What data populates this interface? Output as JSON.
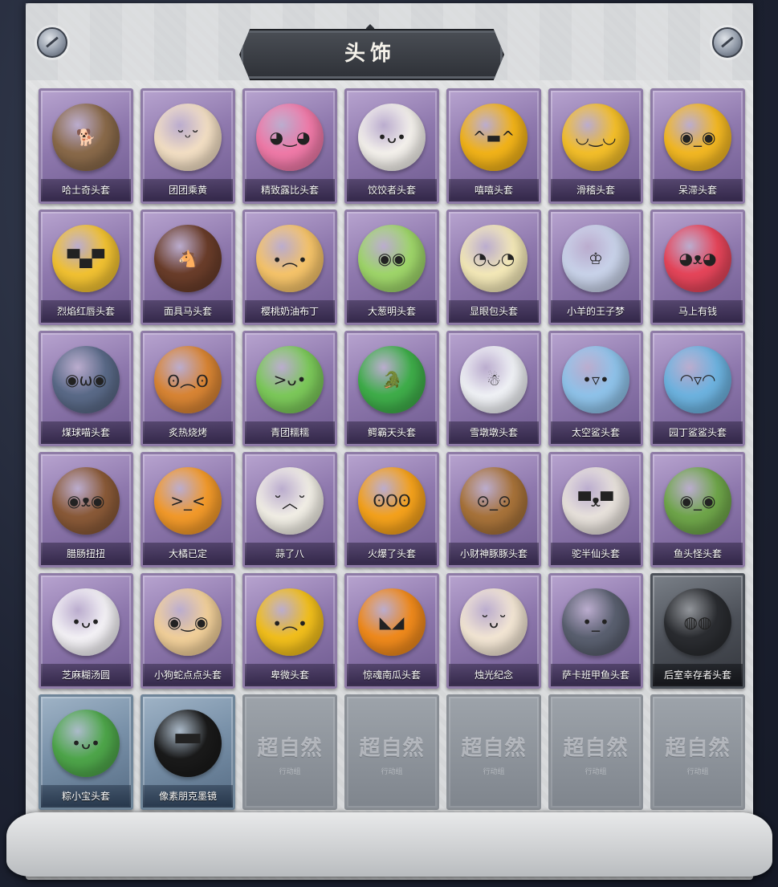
{
  "title": "头饰",
  "items": [
    {
      "label": "哈士奇头套",
      "color": "#8a6a4a",
      "icon_name": "husky-mask-icon",
      "glyph": "🐕"
    },
    {
      "label": "团团乘黄",
      "color": "#f3dfc4",
      "icon_name": "chenghuang-plush-icon",
      "glyph": "˘ᵕ˘"
    },
    {
      "label": "精致露比头套",
      "color": "#f07aa8",
      "icon_name": "ruby-mask-icon",
      "glyph": "◕‿◕"
    },
    {
      "label": "饺饺者头套",
      "color": "#f4f1ec",
      "icon_name": "dumpling-mask-icon",
      "glyph": "•ᴗ•"
    },
    {
      "label": "嘻嘻头套",
      "color": "#f2b319",
      "icon_name": "grin-emoji-mask-icon",
      "glyph": "^▬^"
    },
    {
      "label": "滑稽头套",
      "color": "#f4bf2a",
      "icon_name": "funny-emoji-mask-icon",
      "glyph": "◡‿◡"
    },
    {
      "label": "呆滞头套",
      "color": "#f3b823",
      "icon_name": "dazed-emoji-mask-icon",
      "glyph": "◉_◉"
    },
    {
      "label": "烈焰红唇头套",
      "color": "#f2c232",
      "icon_name": "red-lips-mask-icon",
      "glyph": "▀▄▀"
    },
    {
      "label": "面具马头套",
      "color": "#6a3d2a",
      "icon_name": "horse-mask-icon",
      "glyph": "🐴"
    },
    {
      "label": "樱桃奶油布丁",
      "color": "#f6c46a",
      "icon_name": "pudding-mask-icon",
      "glyph": "•︵•"
    },
    {
      "label": "大葱明头套",
      "color": "#9fd66a",
      "icon_name": "scallion-mask-icon",
      "glyph": "◉◉"
    },
    {
      "label": "显眼包头套",
      "color": "#f4e9b8",
      "icon_name": "lightbulb-mask-icon",
      "glyph": "◔◡◔"
    },
    {
      "label": "小羊的王子梦",
      "color": "#c9d3ea",
      "icon_name": "sheep-prince-mask-icon",
      "glyph": "♔"
    },
    {
      "label": "马上有钱",
      "color": "#e6455a",
      "icon_name": "lucky-horse-mask-icon",
      "glyph": "◕ᴥ◕"
    },
    {
      "label": "煤球喵头套",
      "color": "#5a6a88",
      "icon_name": "black-cat-mask-icon",
      "glyph": "◉ω◉"
    },
    {
      "label": "炙热烧烤",
      "color": "#d98534",
      "icon_name": "bbq-meat-mask-icon",
      "glyph": "ʘ︵ʘ"
    },
    {
      "label": "青团糯糯",
      "color": "#7cc95a",
      "icon_name": "green-rice-ball-mask-icon",
      "glyph": ">ᴗ•"
    },
    {
      "label": "鳄霸天头套",
      "color": "#3fae4a",
      "icon_name": "crocodile-mask-icon",
      "glyph": "🐊"
    },
    {
      "label": "雪墩墩头套",
      "color": "#f0f2f6",
      "icon_name": "snowman-mask-icon",
      "glyph": "☃"
    },
    {
      "label": "太空鲨头套",
      "color": "#8fc3ea",
      "icon_name": "space-shark-mask-icon",
      "glyph": "•▿•"
    },
    {
      "label": "园丁鲨鲨头套",
      "color": "#6db3e0",
      "icon_name": "gardener-shark-mask-icon",
      "glyph": "◠▿◠"
    },
    {
      "label": "腊肠扭扭",
      "color": "#8a5a38",
      "icon_name": "dachshund-mask-icon",
      "glyph": "◉ᴥ◉"
    },
    {
      "label": "大橘已定",
      "color": "#f39a2a",
      "icon_name": "orange-slice-mask-icon",
      "glyph": ">_<"
    },
    {
      "label": "蒜了八",
      "color": "#f2efe6",
      "icon_name": "garlic-mask-icon",
      "glyph": "˘︿˘"
    },
    {
      "label": "火爆了头套",
      "color": "#f5a21c",
      "icon_name": "fire-spirit-mask-icon",
      "glyph": "ʘOʘ"
    },
    {
      "label": "小财神豚豚头套",
      "color": "#a8733a",
      "icon_name": "capybara-god-mask-icon",
      "glyph": "⊙_⊙"
    },
    {
      "label": "驼半仙头套",
      "color": "#e8e2dc",
      "icon_name": "alpaca-sunglasses-mask-icon",
      "glyph": "▀ᴥ▀"
    },
    {
      "label": "鱼头怪头套",
      "color": "#6fa64a",
      "icon_name": "fish-head-mask-icon",
      "glyph": "◉_◉"
    },
    {
      "label": "芝麻糊汤圆",
      "color": "#f4f2f6",
      "icon_name": "sesame-tangyuan-mask-icon",
      "glyph": "•ᴗ•"
    },
    {
      "label": "小狗蛇点点头套",
      "color": "#f2d09a",
      "icon_name": "dog-snake-mask-icon",
      "glyph": "◉‿◉"
    },
    {
      "label": "卑微头套",
      "color": "#f2bf1c",
      "icon_name": "humble-emoji-mask-icon",
      "glyph": "•︵•"
    },
    {
      "label": "惊魂南瓜头套",
      "color": "#f08a1c",
      "icon_name": "pumpkin-mask-icon",
      "glyph": "◣◢"
    },
    {
      "label": "烛光纪念",
      "color": "#f3e6d4",
      "icon_name": "candle-mask-icon",
      "glyph": "˘ᴗ˘"
    },
    {
      "label": "萨卡班甲鱼头套",
      "color": "#5a6070",
      "icon_name": "sacabambaspis-mask-icon",
      "glyph": "•_•"
    },
    {
      "label": "后室幸存者头套",
      "color": "#2a2c30",
      "icon_name": "gas-mask-helmet-icon",
      "glyph": "◍◍"
    },
    {
      "label": "粽小宝头套",
      "color": "#4ea64a",
      "icon_name": "zongzi-mask-icon",
      "glyph": "•ᴗ•"
    },
    {
      "label": "像素朋克墨镜",
      "color": "#1a1a1a",
      "icon_name": "pixel-sunglasses-icon",
      "glyph": "▀▀"
    }
  ],
  "placeholder_text": "超自然",
  "placeholder_subtext": "行动组"
}
